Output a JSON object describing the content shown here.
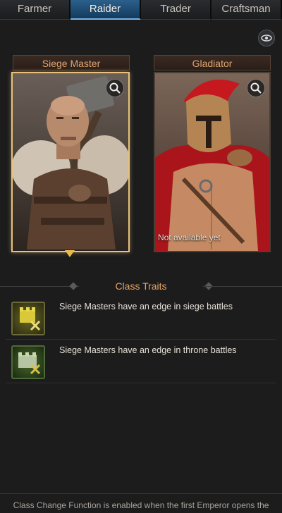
{
  "tabs": [
    {
      "label": "Farmer"
    },
    {
      "label": "Raider"
    },
    {
      "label": "Trader"
    },
    {
      "label": "Craftsman"
    }
  ],
  "active_tab": "Raider",
  "classes": [
    {
      "title": "Siege Master",
      "selected": true
    },
    {
      "title": "Gladiator",
      "status": "Not available yet"
    }
  ],
  "traits": {
    "title": "Class Traits",
    "items": [
      {
        "text": "Siege Masters have an edge in siege battles",
        "icon": "siege-trait-icon"
      },
      {
        "text": "Siege Masters have an edge in throne battles",
        "icon": "throne-trait-icon"
      }
    ]
  },
  "footer": {
    "text": "Class Change Function is enabled when the first Emperor opens the"
  },
  "colors": {
    "accent": "#e3a464",
    "tab_active": "#1f4f78",
    "selected_border": "#e8c27a"
  }
}
